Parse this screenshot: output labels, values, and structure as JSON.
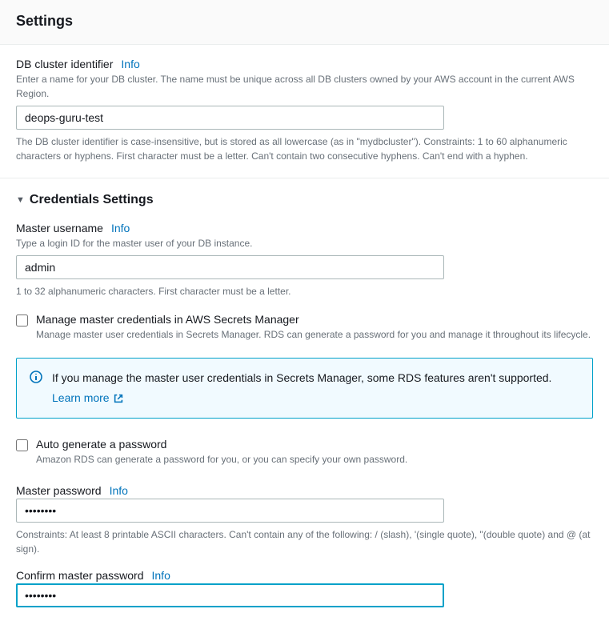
{
  "header": {
    "title": "Settings"
  },
  "db_identifier": {
    "label": "DB cluster identifier",
    "info": "Info",
    "description": "Enter a name for your DB cluster. The name must be unique across all DB clusters owned by your AWS account in the current AWS Region.",
    "value": "deops-guru-test",
    "constraint": "The DB cluster identifier is case-insensitive, but is stored as all lowercase (as in \"mydbcluster\"). Constraints: 1 to 60 alphanumeric characters or hyphens. First character must be a letter. Can't contain two consecutive hyphens. Can't end with a hyphen."
  },
  "credentials": {
    "section_title": "Credentials Settings",
    "master_username": {
      "label": "Master username",
      "info": "Info",
      "description": "Type a login ID for the master user of your DB instance.",
      "value": "admin",
      "constraint": "1 to 32 alphanumeric characters. First character must be a letter."
    },
    "secrets_manager": {
      "label": "Manage master credentials in AWS Secrets Manager",
      "description": "Manage master user credentials in Secrets Manager. RDS can generate a password for you and manage it throughout its lifecycle."
    },
    "alert": {
      "text": "If you manage the master user credentials in Secrets Manager, some RDS features aren't supported.",
      "learn_more": "Learn more"
    },
    "auto_generate": {
      "label": "Auto generate a password",
      "description": "Amazon RDS can generate a password for you, or you can specify your own password."
    },
    "master_password": {
      "label": "Master password",
      "info": "Info",
      "value": "••••••••",
      "constraint": "Constraints: At least 8 printable ASCII characters. Can't contain any of the following: / (slash), '(single quote), \"(double quote) and @ (at sign)."
    },
    "confirm_password": {
      "label": "Confirm master password",
      "info": "Info",
      "value": "••••••••"
    }
  }
}
